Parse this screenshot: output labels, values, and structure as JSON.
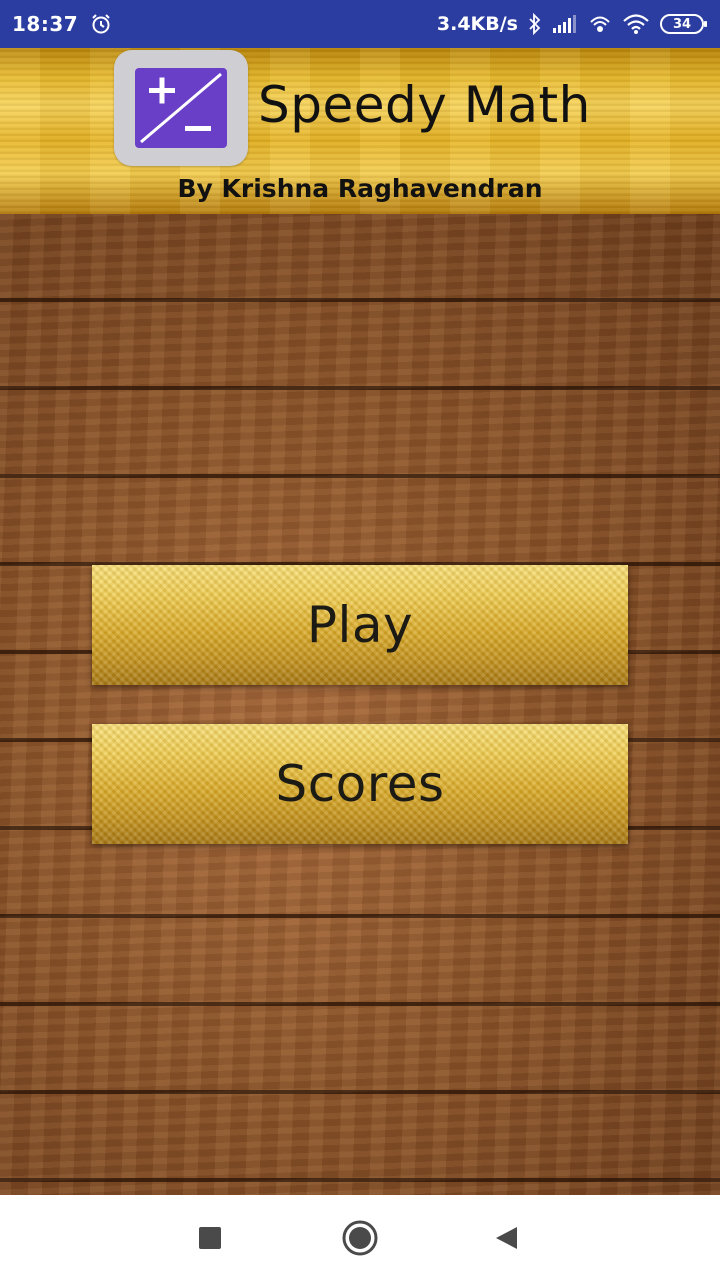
{
  "status_bar": {
    "time": "18:37",
    "network_speed": "3.4KB/s",
    "battery_level": "34",
    "icons": [
      "alarm-icon",
      "bluetooth-icon",
      "signal-icon",
      "hotspot-icon",
      "wifi-icon",
      "battery-icon"
    ]
  },
  "header": {
    "title": "Speedy Math",
    "subtitle": "By Krishna Raghavendran",
    "icon": "plus-minus-app-icon",
    "colors": {
      "icon_bg": "#cfcfd3",
      "icon_fg": "#6a3fc8"
    }
  },
  "buttons": {
    "play_label": "Play",
    "scores_label": "Scores"
  },
  "navigation": {
    "icons": [
      "recent-apps-icon",
      "home-icon",
      "back-icon"
    ]
  },
  "colors": {
    "status_bar": "#2b3da0",
    "gold": "#e5b325",
    "wood": "#8a5329"
  }
}
